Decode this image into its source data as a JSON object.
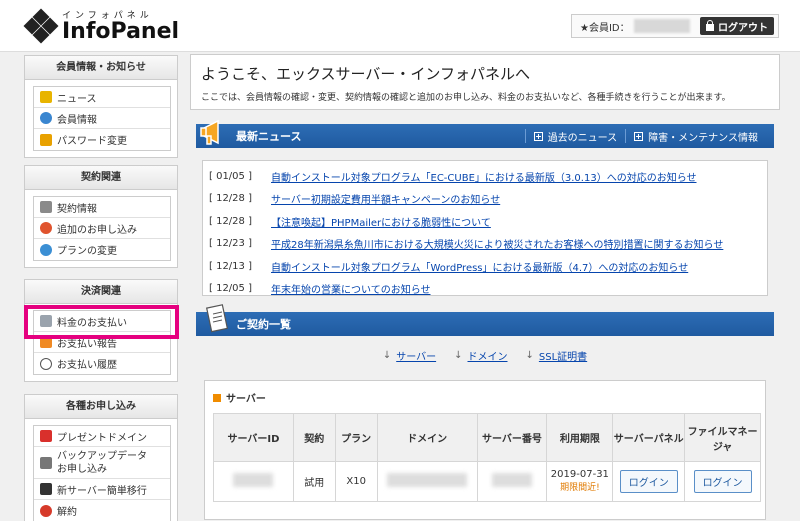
{
  "header": {
    "logo_kana": "インフォパネル",
    "logo_name": "InfoPanel",
    "member_label": "★会員ID：",
    "logout_label": "ログアウト"
  },
  "sidebar": {
    "groups": [
      {
        "title": "会員情報・お知らせ",
        "items": [
          {
            "label": "ニュース",
            "icon": "key-icon"
          },
          {
            "label": "会員情報",
            "icon": "person-icon"
          },
          {
            "label": "パスワード変更",
            "icon": "lock-icon"
          }
        ]
      },
      {
        "title": "契約関連",
        "items": [
          {
            "label": "契約情報",
            "icon": "pen-icon"
          },
          {
            "label": "追加のお申し込み",
            "icon": "plus-circle-icon"
          },
          {
            "label": "プランの変更",
            "icon": "refresh-icon"
          }
        ]
      },
      {
        "title": "決済関連",
        "items": [
          {
            "label": "料金のお支払い",
            "icon": "calculator-icon"
          },
          {
            "label": "お支払い報告",
            "icon": "report-icon"
          },
          {
            "label": "お支払い履歴",
            "icon": "clock-icon"
          }
        ]
      },
      {
        "title": "各種お申し込み",
        "items": [
          {
            "label": "プレゼントドメイン",
            "icon": "gift-icon"
          },
          {
            "label": "バックアップデータ",
            "label2": "お申し込み",
            "icon": "backup-icon"
          },
          {
            "label": "新サーバー簡単移行",
            "icon": "server-icon"
          },
          {
            "label": "解約",
            "icon": "cancel-icon"
          }
        ]
      }
    ]
  },
  "welcome": {
    "title": "ようこそ、エックスサーバー・インフォパネルへ",
    "subtitle": "ここでは、会員情報の確認・変更、契約情報の確認と追加のお申し込み、料金のお支払いなど、各種手続きを行うことが出来ます。"
  },
  "news": {
    "title": "最新ニュース",
    "link_past": "過去のニュース",
    "link_maintenance": "障害・メンテナンス情報",
    "items": [
      {
        "date": "[ 01/05 ]",
        "text": "自動インストール対象プログラム「EC-CUBE」における最新版（3.0.13）への対応のお知らせ"
      },
      {
        "date": "[ 12/28 ]",
        "text": "サーバー初期設定費用半額キャンペーンのお知らせ"
      },
      {
        "date": "[ 12/28 ]",
        "text": "【注意喚起】PHPMailerにおける脆弱性について"
      },
      {
        "date": "[ 12/23 ]",
        "text": "平成28年新潟県糸魚川市における大規模火災により被災されたお客様への特別措置に関するお知らせ"
      },
      {
        "date": "[ 12/13 ]",
        "text": "自動インストール対象プログラム「WordPress」における最新版（4.7）への対応のお知らせ"
      },
      {
        "date": "[ 12/05 ]",
        "text": "年末年始の営業についてのお知らせ"
      }
    ]
  },
  "contract": {
    "title": "ご契約一覧",
    "anchors": [
      "サーバー",
      "ドメイン",
      "SSL証明書"
    ],
    "server_section_title": "サーバー",
    "columns": [
      "サーバーID",
      "契約",
      "プラン",
      "ドメイン",
      "サーバー番号",
      "利用期限",
      "サーバーパネル",
      "ファイルマネージャ"
    ],
    "row": {
      "contract": "試用",
      "plan": "X10",
      "expiry": "2019-07-31",
      "expiry_note": "期限間近!",
      "server_panel_button": "ログイン",
      "file_manager_button": "ログイン"
    }
  }
}
